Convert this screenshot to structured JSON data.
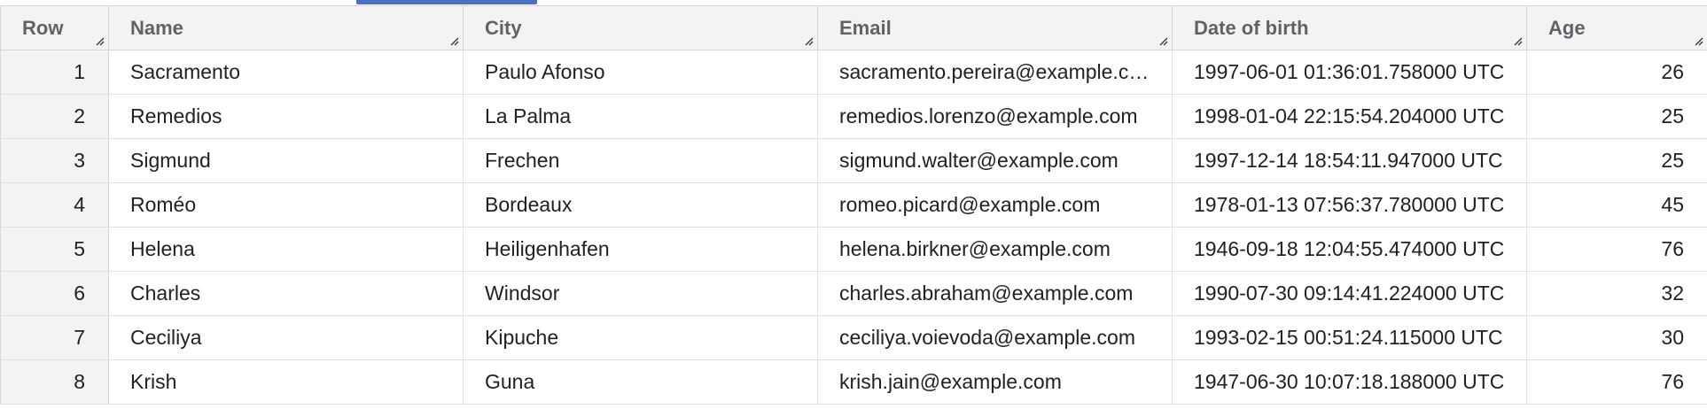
{
  "table": {
    "columns": [
      "Row",
      "Name",
      "City",
      "Email",
      "Date of birth",
      "Age"
    ],
    "rows": [
      {
        "row": "1",
        "name": "Sacramento",
        "city": "Paulo Afonso",
        "email": "sacramento.pereira@example.com",
        "dob": "1997-06-01 01:36:01.758000 UTC",
        "age": "26"
      },
      {
        "row": "2",
        "name": "Remedios",
        "city": "La Palma",
        "email": "remedios.lorenzo@example.com",
        "dob": "1998-01-04 22:15:54.204000 UTC",
        "age": "25"
      },
      {
        "row": "3",
        "name": "Sigmund",
        "city": "Frechen",
        "email": "sigmund.walter@example.com",
        "dob": "1997-12-14 18:54:11.947000 UTC",
        "age": "25"
      },
      {
        "row": "4",
        "name": "Roméo",
        "city": "Bordeaux",
        "email": "romeo.picard@example.com",
        "dob": "1978-01-13 07:56:37.780000 UTC",
        "age": "45"
      },
      {
        "row": "5",
        "name": "Helena",
        "city": "Heiligenhafen",
        "email": "helena.birkner@example.com",
        "dob": "1946-09-18 12:04:55.474000 UTC",
        "age": "76"
      },
      {
        "row": "6",
        "name": "Charles",
        "city": "Windsor",
        "email": "charles.abraham@example.com",
        "dob": "1990-07-30 09:14:41.224000 UTC",
        "age": "32"
      },
      {
        "row": "7",
        "name": "Ceciliya",
        "city": "Kipuche",
        "email": "ceciliya.voievoda@example.com",
        "dob": "1993-02-15 00:51:24.115000 UTC",
        "age": "30"
      },
      {
        "row": "8",
        "name": "Krish",
        "city": "Guna",
        "email": "krish.jain@example.com",
        "dob": "1947-06-30 10:07:18.188000 UTC",
        "age": "76"
      }
    ]
  },
  "icons": {
    "column_resize": "resize-handle-icon"
  },
  "colors": {
    "tab_indicator": "#4a6fc9",
    "header_bg": "#f3f3f3"
  }
}
